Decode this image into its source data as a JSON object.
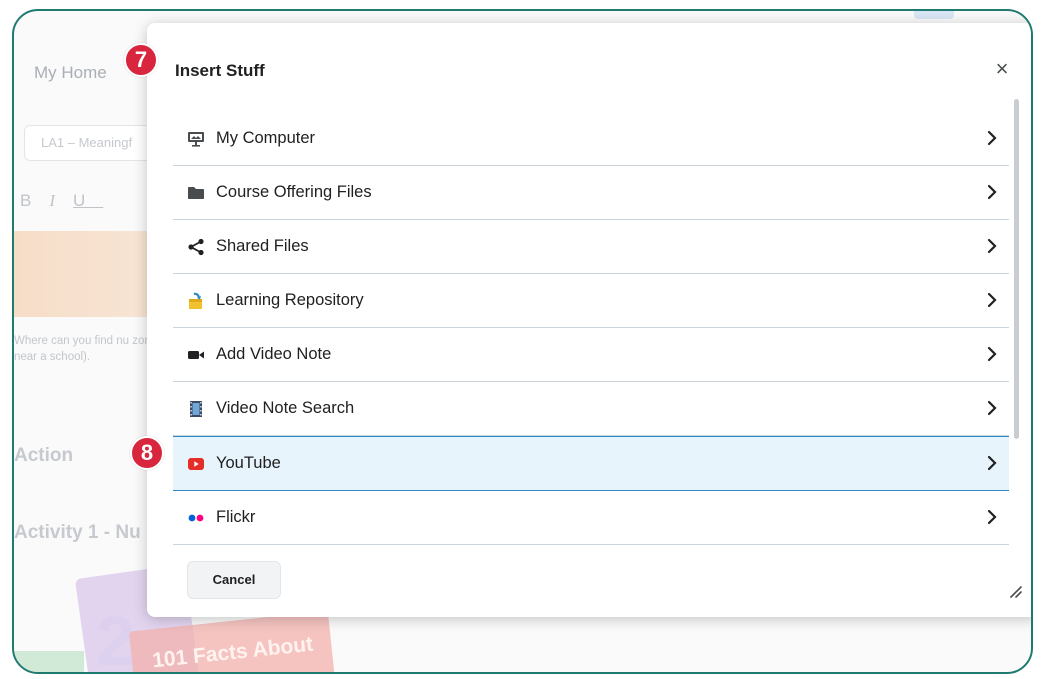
{
  "background": {
    "home_link": "My Home",
    "title_field_value": "LA1 – Meaningf",
    "format_bold": "B",
    "format_italic": "I",
    "format_underline": "U",
    "hint_text": "Where can you find nu zone near a school).",
    "heading_action": "Action",
    "heading_activity": "Activity 1 - Nu",
    "book_number": "2",
    "book_title": "101 Facts About"
  },
  "dialog": {
    "title": "Insert Stuff",
    "close_symbol": "×",
    "items": [
      {
        "label": "My Computer",
        "icon": "monitor-icon"
      },
      {
        "label": "Course Offering Files",
        "icon": "folder-icon"
      },
      {
        "label": "Shared Files",
        "icon": "share-icon"
      },
      {
        "label": "Learning Repository",
        "icon": "repository-icon"
      },
      {
        "label": "Add Video Note",
        "icon": "video-camera-icon"
      },
      {
        "label": "Video Note Search",
        "icon": "film-icon"
      },
      {
        "label": "YouTube",
        "icon": "youtube-icon",
        "selected": true
      },
      {
        "label": "Flickr",
        "icon": "flickr-icon"
      }
    ],
    "cancel_label": "Cancel"
  },
  "badges": {
    "step_seven": "7",
    "step_eight": "8"
  },
  "colors": {
    "frame_border": "#1f7a70",
    "badge": "#d7263d",
    "selected_row_bg": "#e8f4fb",
    "selected_row_border": "#2b89c6",
    "youtube_red": "#e52d27",
    "flickr_blue": "#0063dc",
    "flickr_pink": "#ff0084"
  }
}
